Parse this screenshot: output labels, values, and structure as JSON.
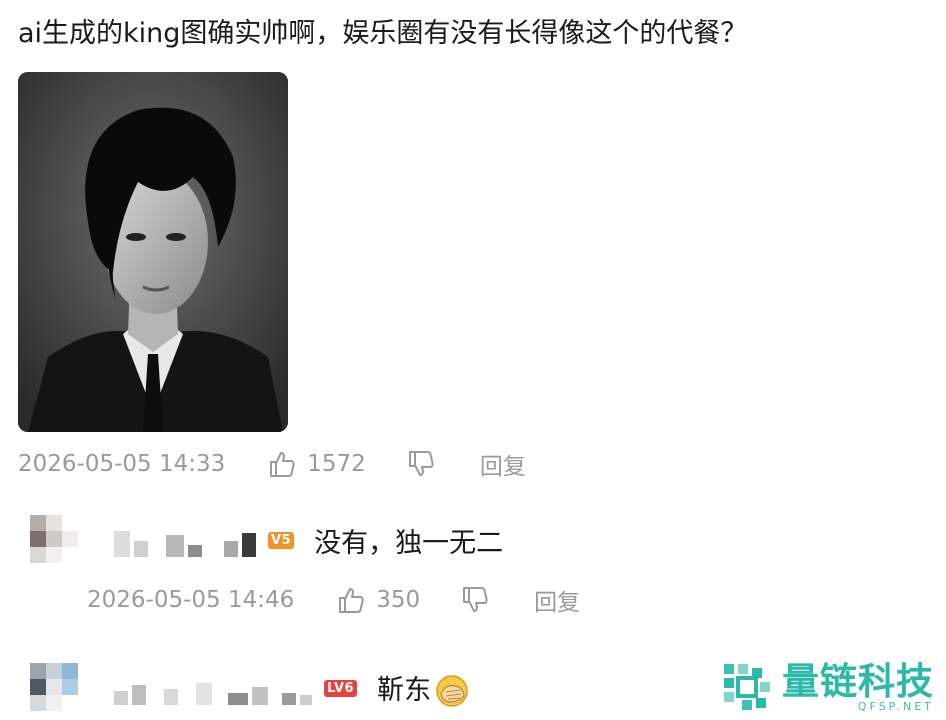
{
  "post": {
    "text": "ai生成的king图确实帅啊，娱乐圈有没有长得像这个的代餐？",
    "timestamp": "2026-05-05 14:33",
    "likes": "1572",
    "reply_label": "回复"
  },
  "comments": [
    {
      "level": "V5",
      "text": "没有，独一无二",
      "timestamp": "2026-05-05 14:46",
      "likes": "350",
      "reply_label": "回复"
    },
    {
      "level": "LV6",
      "text": "靳东"
    }
  ],
  "watermark": {
    "brand": "量链科技",
    "url": "QFSP.NET"
  },
  "colors": {
    "meta_gray": "#9a9a9a",
    "badge_orange": "#f0932a",
    "badge_red": "#e8423f",
    "watermark_teal": "#2bb9a8"
  },
  "icons": {
    "like": "thumbs-up-icon",
    "dislike": "thumbs-down-icon",
    "emoji": "facepalm-emoji-icon"
  }
}
